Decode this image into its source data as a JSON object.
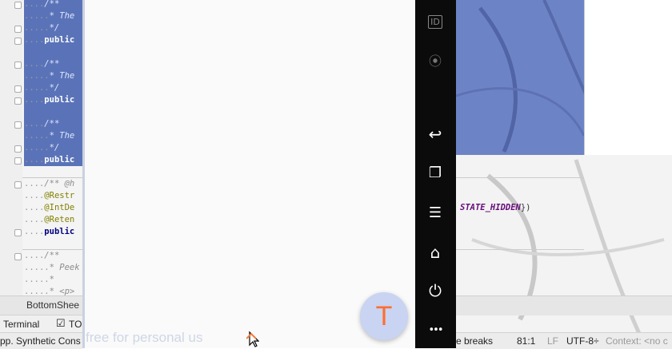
{
  "editor": {
    "lines": [
      {
        "dots": "....",
        "text": "/**",
        "cls": "cm",
        "selected": true
      },
      {
        "dots": ".....",
        "text": "* The",
        "cls": "cm",
        "selected": true
      },
      {
        "dots": ".....",
        "text": "*/",
        "cls": "cm",
        "selected": true
      },
      {
        "dots": "....",
        "text": "public",
        "cls": "kw",
        "selected": true
      },
      {
        "dots": "",
        "text": "",
        "cls": "",
        "selected": true
      },
      {
        "dots": "....",
        "text": "/**",
        "cls": "cm",
        "selected": true
      },
      {
        "dots": ".....",
        "text": "* The",
        "cls": "cm",
        "selected": true
      },
      {
        "dots": ".....",
        "text": "*/",
        "cls": "cm",
        "selected": true
      },
      {
        "dots": "....",
        "text": "public",
        "cls": "kw",
        "selected": true
      },
      {
        "dots": "",
        "text": "",
        "cls": "",
        "selected": true
      },
      {
        "dots": "....",
        "text": "/**",
        "cls": "cm",
        "selected": true
      },
      {
        "dots": ".....",
        "text": "* The",
        "cls": "cm",
        "selected": true
      },
      {
        "dots": ".....",
        "text": "*/",
        "cls": "cm",
        "selected": true
      },
      {
        "dots": "....",
        "text": "public",
        "cls": "kw",
        "selected": true
      },
      {
        "dots": "",
        "text": "",
        "cls": "",
        "selected": false
      },
      {
        "dots": "....",
        "text": "/** @h",
        "cls": "cm",
        "selected": false
      },
      {
        "dots": "....",
        "text": "@Restr",
        "cls": "ann",
        "selected": false
      },
      {
        "dots": "....",
        "text": "@IntDe",
        "cls": "ann",
        "selected": false
      },
      {
        "dots": "....",
        "text": "@Reten",
        "cls": "ann",
        "selected": false
      },
      {
        "dots": "....",
        "text": "public",
        "cls": "kw",
        "selected": false
      },
      {
        "dots": "",
        "text": "",
        "cls": "",
        "selected": false
      },
      {
        "dots": "....",
        "text": "/**",
        "cls": "cm",
        "selected": false
      },
      {
        "dots": ".....",
        "text": "* Peek",
        "cls": "cm",
        "selected": false
      },
      {
        "dots": ".....",
        "text": "*",
        "cls": "cm",
        "selected": false
      },
      {
        "dots": ".....",
        "text": "* <p>",
        "cls": "cm",
        "selected": false
      }
    ]
  },
  "code_fragment": {
    "constant": "STATE_HIDDEN",
    "suffix": "})"
  },
  "emulator": {
    "fab_letter": "T",
    "buttons": [
      {
        "name": "id-button",
        "icon": "ID"
      },
      {
        "name": "camera-button",
        "icon": "⦿"
      },
      {
        "name": "back-button",
        "icon": "↩"
      },
      {
        "name": "recents-button",
        "icon": "❐"
      },
      {
        "name": "menu-button",
        "icon": "☰"
      },
      {
        "name": "home-button",
        "icon": "⌂"
      },
      {
        "name": "power-button",
        "icon": "⏻"
      },
      {
        "name": "more-button",
        "icon": "•••"
      }
    ]
  },
  "tabs": {
    "editor_tab": "BottomShee"
  },
  "toolwindows": {
    "terminal": "Terminal",
    "todo": "TO"
  },
  "status": {
    "message": "pp. Synthetic Cons",
    "line_breaks": "e breaks",
    "position": "81:1",
    "line_sep": "LF",
    "encoding": "UTF-8÷",
    "context": "Context: <no c"
  },
  "watermark": "free for personal us",
  "colors": {
    "selection": "#5a73b8",
    "fab_bg": "#c9d3f2",
    "fab_letter": "#ff6d2d"
  }
}
